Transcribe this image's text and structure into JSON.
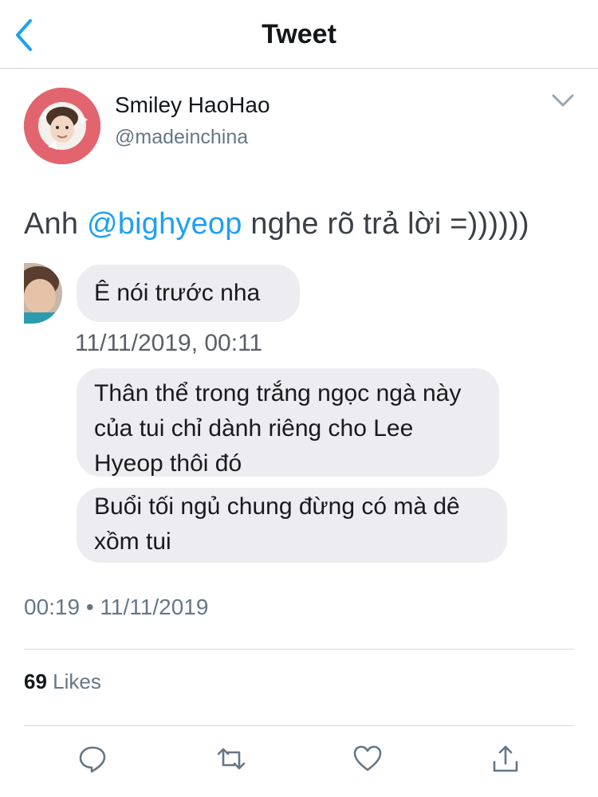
{
  "nav": {
    "title": "Tweet"
  },
  "author": {
    "display_name": "Smiley HaoHao",
    "handle": "@madeinchina"
  },
  "tweet": {
    "text_prefix": "Anh ",
    "mention": "@bighyeop",
    "text_suffix": " nghe rõ trả lời =))))))"
  },
  "screenshot": {
    "messages": [
      "Ê nói trước nha",
      "Thân thể trong trắng ngọc ngà này của tui chỉ dành riêng cho Lee Hyeop thôi đó",
      "Buổi tối ngủ chung đừng có mà dê xồm tui"
    ],
    "message_time": "11/11/2019, 00:11"
  },
  "meta": {
    "timestamp": "00:19 • 11/11/2019"
  },
  "stats": {
    "likes_count": "69",
    "likes_label": "Likes"
  },
  "actions": [
    {
      "icon": "reply-icon"
    },
    {
      "icon": "retweet-icon"
    },
    {
      "icon": "like-icon"
    },
    {
      "icon": "share-icon"
    }
  ],
  "colors": {
    "accent": "#1da1f2",
    "secondary_text": "#657786",
    "bubble": "#ececf1"
  }
}
